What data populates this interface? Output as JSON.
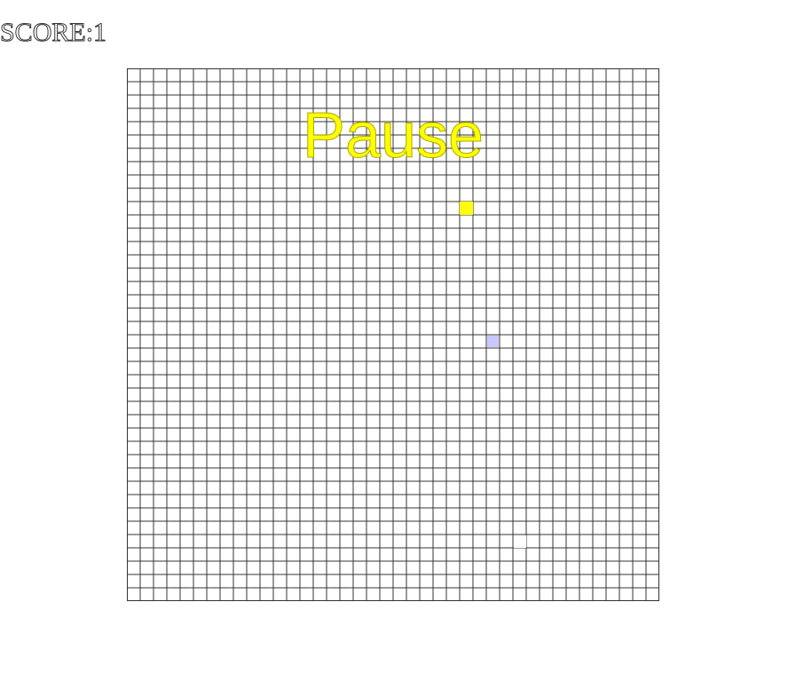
{
  "hud": {
    "score_text": "SCORE:1"
  },
  "board": {
    "columns": 40,
    "rows": 40,
    "grid_line_color": "#333333",
    "cell_fill": "#ffffff",
    "pause_text": "Pause",
    "pause_color": "#ffff00",
    "food": {
      "col": 25,
      "row": 10,
      "color": "#ffff00"
    },
    "snake": {
      "color": "#ffffff",
      "segments": [
        {
          "col": 29,
          "row": 35
        }
      ]
    },
    "highlight_cells": [
      {
        "col": 27,
        "row": 20,
        "color": "#c8c8ff"
      }
    ]
  }
}
